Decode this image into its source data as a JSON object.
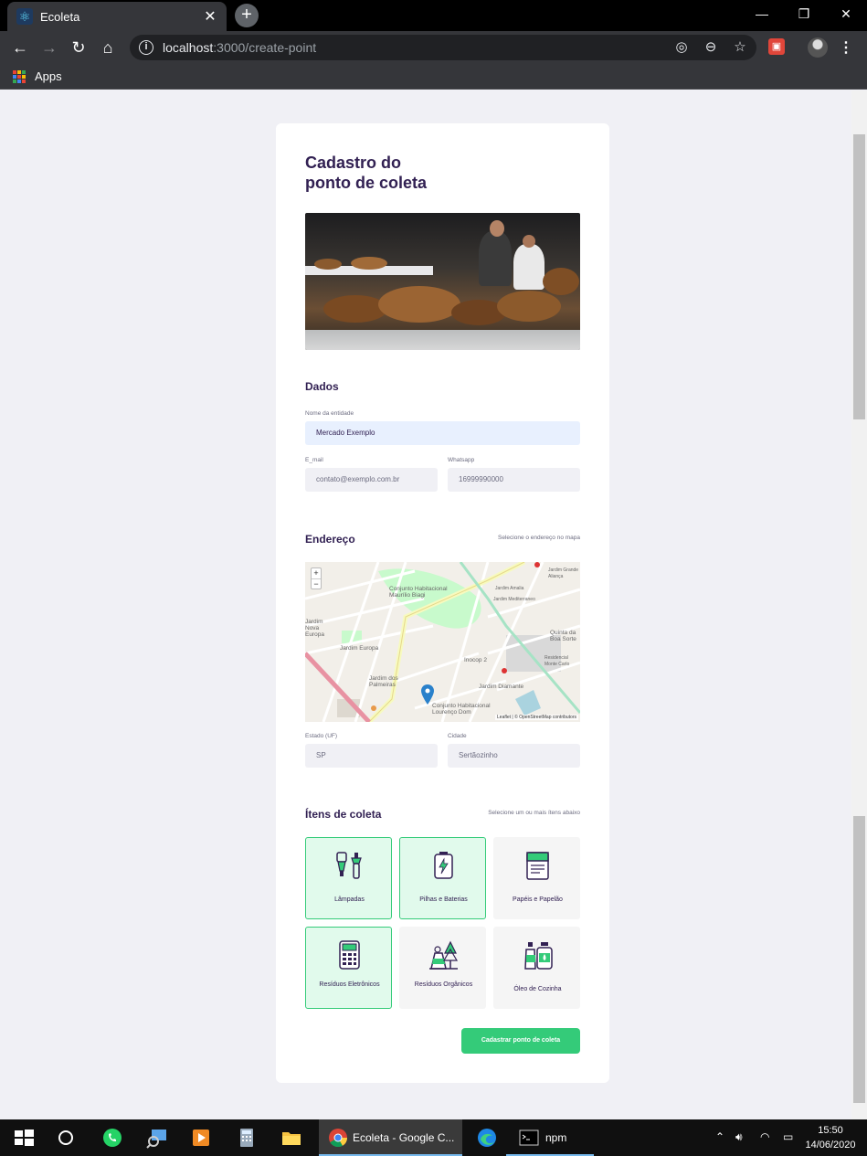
{
  "browser": {
    "tab_title": "Ecoleta",
    "url_host": "localhost",
    "url_path": ":3000/create-point",
    "bookmarks_label": "Apps"
  },
  "page": {
    "title_line1": "Cadastro do",
    "title_line2": "ponto de coleta"
  },
  "dados": {
    "heading": "Dados",
    "name_label": "Nome da entidade",
    "name_value": "Mercado Exemplo",
    "email_label": "E_mail",
    "email_placeholder": "contato@exemplo.com.br",
    "whatsapp_label": "Whatsapp",
    "whatsapp_placeholder": "16999990000"
  },
  "endereco": {
    "heading": "Endereço",
    "hint": "Selecione o endereço no mapa",
    "map_labels": [
      "Conjunto Habitacional Maurílio Biagi",
      "Jardim Europa",
      "Jardim dos Palmeiras",
      "Jardim Diamante",
      "Conjunto Habitacional Lourenço Dom",
      "Quinta da Boa Sorte",
      "Residencial Monte Carlo",
      "Jardim Nova Europa",
      "Jardim Amalia",
      "Jardim Mediterraneo",
      "Jardim Grande Aliança",
      "Inocop 2"
    ],
    "map_attribution": "Leaflet | © OpenStreetMap contributors",
    "zoom_in": "+",
    "zoom_out": "−",
    "uf_label": "Estado (UF)",
    "uf_value": "SP",
    "city_label": "Cidade",
    "city_value": "Sertãozinho"
  },
  "itens": {
    "heading": "Ítens de coleta",
    "hint": "Selecione um ou mais ítens abaixo",
    "items": [
      {
        "label": "Lâmpadas",
        "selected": true,
        "icon": "lamps-icon"
      },
      {
        "label": "Pilhas e Baterias",
        "selected": true,
        "icon": "battery-icon"
      },
      {
        "label": "Papéis e Papelão",
        "selected": false,
        "icon": "paper-icon"
      },
      {
        "label": "Resíduos Eletrônicos",
        "selected": true,
        "icon": "electronics-icon"
      },
      {
        "label": "Resíduos Orgânicos",
        "selected": false,
        "icon": "organic-icon"
      },
      {
        "label": "Óleo de Cozinha",
        "selected": false,
        "icon": "oil-icon"
      }
    ]
  },
  "submit_label": "Cadastrar ponto de coleta",
  "taskbar": {
    "chrome_label": "Ecoleta - Google C...",
    "npm_label": "npm",
    "time": "15:50",
    "date": "14/06/2020"
  },
  "colors": {
    "title": "#322153",
    "accent_green": "#34cb79",
    "selected_bg": "#e1faec",
    "field_bg": "#f0f0f5"
  }
}
